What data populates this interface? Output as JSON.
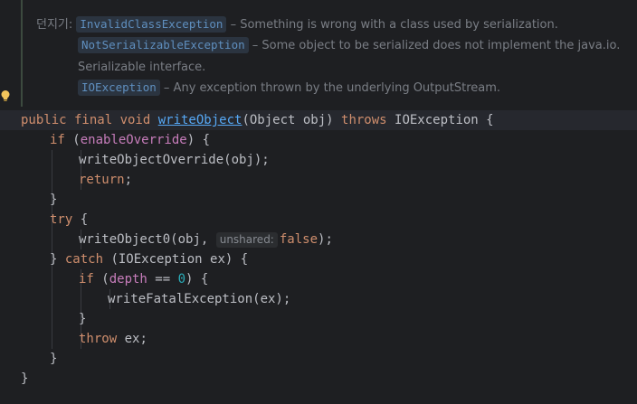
{
  "javadoc": {
    "throws_label": "던지기:",
    "items": [
      {
        "exception": "InvalidClassException",
        "description": " – Something is wrong with a class used by serialization."
      },
      {
        "exception": "NotSerializableException",
        "description": " – Some object to be serialized does not implement the java.io."
      },
      {
        "continuation": "Serializable interface."
      },
      {
        "exception": "IOException",
        "description": " – Any exception thrown by the underlying OutputStream."
      }
    ]
  },
  "code": {
    "l1": {
      "kw1": "public final void ",
      "name": "writeObject",
      "rest": "(Object obj) ",
      "kw2": "throws",
      "tail": " IOException {"
    },
    "l2": {
      "kw": "if",
      "open": " (",
      "field": "enableOverride",
      "close": ") {"
    },
    "l3": "writeObjectOverride(obj);",
    "l4": {
      "kw": "return",
      "tail": ";"
    },
    "l5": "}",
    "l6": {
      "kw": "try",
      "tail": " {"
    },
    "l7": {
      "pre": "writeObject0(obj, ",
      "hint": "unshared:",
      "kw": "false",
      "tail": ");"
    },
    "l8": {
      "pre": "} ",
      "kw": "catch",
      "tail": " (IOException ex) {"
    },
    "l9": {
      "kw": "if",
      "open": " (",
      "field": "depth",
      "op": " == ",
      "num": "0",
      "close": ") {"
    },
    "l10": "writeFatalException(ex);",
    "l11": "}",
    "l12": {
      "kw": "throw",
      "tail": " ex;"
    },
    "l13": "}",
    "l14": "}"
  }
}
